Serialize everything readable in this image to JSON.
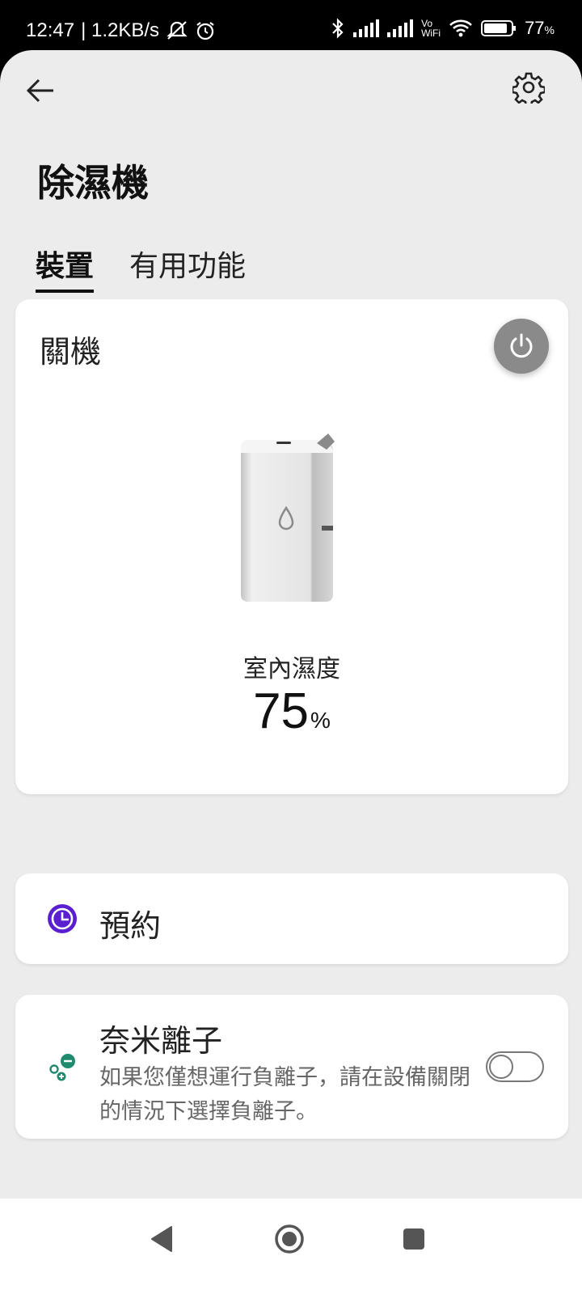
{
  "status_bar": {
    "time": "12:47",
    "speed": "| 1.2KB/s",
    "battery": "77",
    "battery_unit": "%",
    "vowifi_top": "Vo",
    "vowifi_bottom": "WiFi"
  },
  "header": {
    "back_icon": "arrow-left-icon",
    "settings_icon": "gear-icon",
    "title": "除濕機"
  },
  "tabs": [
    {
      "label": "裝置",
      "active": true
    },
    {
      "label": "有用功能",
      "active": false
    }
  ],
  "device_card": {
    "status": "關機",
    "power_icon": "power-icon",
    "humidity_label": "室內濕度",
    "humidity_value": "75",
    "humidity_unit": "%"
  },
  "schedule": {
    "label": "預約",
    "icon": "clock-icon",
    "icon_color": "#5a1fd1"
  },
  "nano_ion": {
    "title": "奈米離子",
    "description": "如果您僅想運行負離子，請在設備關閉的情況下選擇負離子。",
    "icon": "ion-icon",
    "icon_color": "#1f8a6e",
    "toggle_on": false
  },
  "nav": {
    "back": "nav-back-icon",
    "home": "nav-home-icon",
    "recents": "nav-recents-icon"
  }
}
